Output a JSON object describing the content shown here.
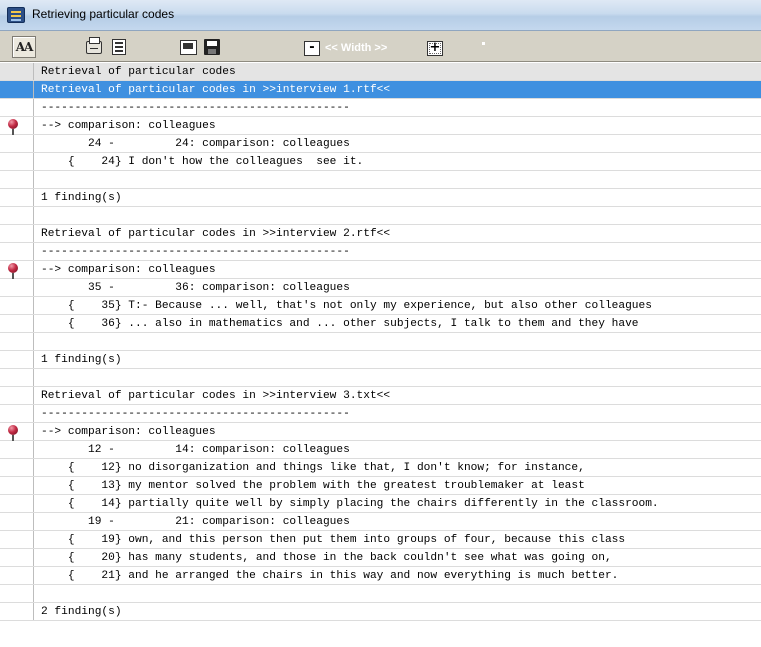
{
  "window": {
    "title": "Retrieving particular codes"
  },
  "toolbar": {
    "width_label": "<< Width >>",
    "minus_label": "-",
    "plus_label": "+",
    "font_label": "AA"
  },
  "lines": [
    {
      "text": "Retrieval of particular codes",
      "kind": "header",
      "marker": false
    },
    {
      "text": "Retrieval of particular codes in >>interview 1.rtf<<",
      "kind": "selected",
      "marker": false
    },
    {
      "text": "----------------------------------------------",
      "kind": "normal",
      "marker": false
    },
    {
      "text": "--> comparison: colleagues",
      "kind": "normal",
      "marker": true
    },
    {
      "text": "       24 -         24: comparison: colleagues",
      "kind": "normal",
      "marker": false
    },
    {
      "text": "    {    24} I don't how the colleagues  see it.",
      "kind": "normal",
      "marker": false
    },
    {
      "text": "",
      "kind": "normal",
      "marker": false
    },
    {
      "text": "1 finding(s)",
      "kind": "normal",
      "marker": false
    },
    {
      "text": "",
      "kind": "normal",
      "marker": false
    },
    {
      "text": "Retrieval of particular codes in >>interview 2.rtf<<",
      "kind": "normal",
      "marker": false
    },
    {
      "text": "----------------------------------------------",
      "kind": "normal",
      "marker": false
    },
    {
      "text": "--> comparison: colleagues",
      "kind": "normal",
      "marker": true
    },
    {
      "text": "       35 -         36: comparison: colleagues",
      "kind": "normal",
      "marker": false
    },
    {
      "text": "    {    35} T:- Because ... well, that's not only my experience, but also other colleagues",
      "kind": "normal",
      "marker": false
    },
    {
      "text": "    {    36} ... also in mathematics and ... other subjects, I talk to them and they have",
      "kind": "normal",
      "marker": false
    },
    {
      "text": "",
      "kind": "normal",
      "marker": false
    },
    {
      "text": "1 finding(s)",
      "kind": "normal",
      "marker": false
    },
    {
      "text": "",
      "kind": "normal",
      "marker": false
    },
    {
      "text": "Retrieval of particular codes in >>interview 3.txt<<",
      "kind": "normal",
      "marker": false
    },
    {
      "text": "----------------------------------------------",
      "kind": "normal",
      "marker": false
    },
    {
      "text": "--> comparison: colleagues",
      "kind": "normal",
      "marker": true
    },
    {
      "text": "       12 -         14: comparison: colleagues",
      "kind": "normal",
      "marker": false
    },
    {
      "text": "    {    12} no disorganization and things like that, I don't know; for instance,",
      "kind": "normal",
      "marker": false
    },
    {
      "text": "    {    13} my mentor solved the problem with the greatest troublemaker at least",
      "kind": "normal",
      "marker": false
    },
    {
      "text": "    {    14} partially quite well by simply placing the chairs differently in the classroom.",
      "kind": "normal",
      "marker": false
    },
    {
      "text": "       19 -         21: comparison: colleagues",
      "kind": "normal",
      "marker": false
    },
    {
      "text": "    {    19} own, and this person then put them into groups of four, because this class",
      "kind": "normal",
      "marker": false
    },
    {
      "text": "    {    20} has many students, and those in the back couldn't see what was going on,",
      "kind": "normal",
      "marker": false
    },
    {
      "text": "    {    21} and he arranged the chairs in this way and now everything is much better.",
      "kind": "normal",
      "marker": false
    },
    {
      "text": "",
      "kind": "normal",
      "marker": false
    },
    {
      "text": "2 finding(s)",
      "kind": "normal",
      "marker": false
    }
  ]
}
